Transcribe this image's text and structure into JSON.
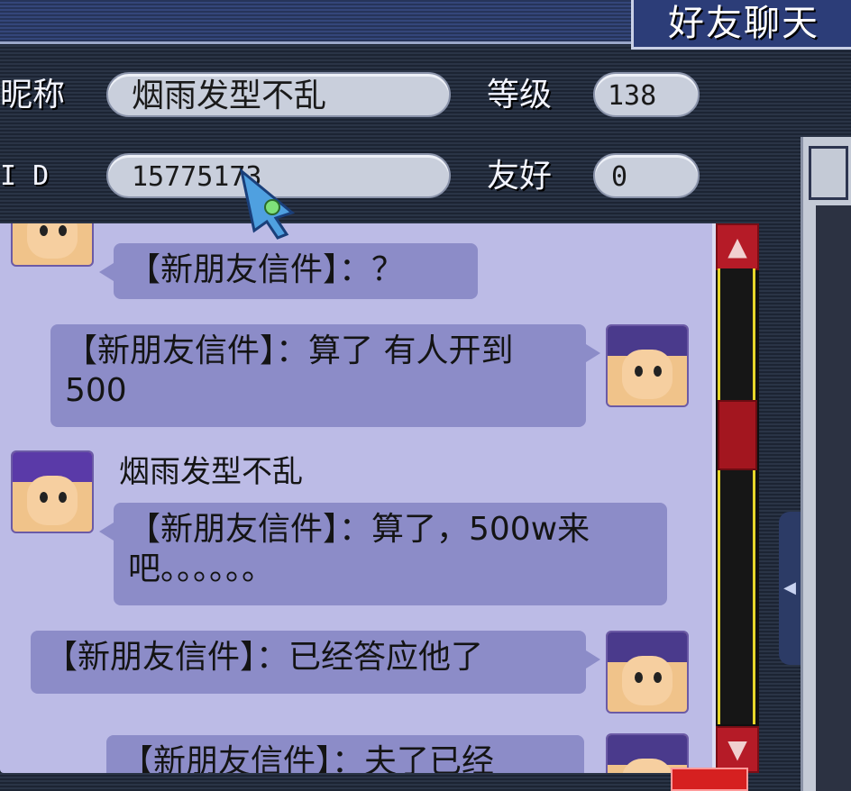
{
  "window": {
    "title": "好友聊天"
  },
  "profile": {
    "nickname_label": "昵称",
    "nickname_value": "烟雨发型不乱",
    "level_label": "等级",
    "level_value": "138",
    "id_label": "I D",
    "id_value": "15775173",
    "friendship_label": "友好",
    "friendship_value": "0"
  },
  "chat": {
    "messages": [
      {
        "side": "left",
        "text": "【新朋友信件】：？"
      },
      {
        "side": "right",
        "text": "【新朋友信件】：算了 有人开到500"
      },
      {
        "side": "left",
        "sender": "烟雨发型不乱",
        "text": "【新朋友信件】：算了，500w来吧。。。。。。"
      },
      {
        "side": "right",
        "text": "【新朋友信件】：已经答应他了"
      },
      {
        "side": "left",
        "text": "【新朋友信件】：夫了已经"
      }
    ]
  },
  "scrollbar": {
    "up": "▲",
    "down": "▼"
  },
  "side_handle": {
    "arrow": "◀"
  },
  "colors": {
    "chat_bg": "#bcbbe6",
    "bubble": "#8c8cc8",
    "scroll_red": "#b51b27",
    "title_bg": "#2c3d78"
  }
}
